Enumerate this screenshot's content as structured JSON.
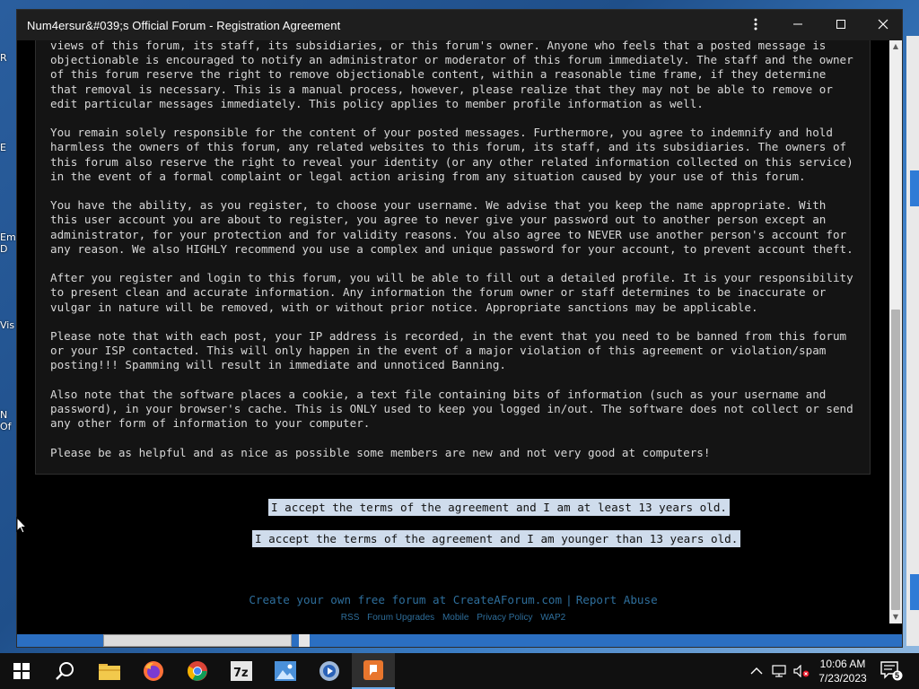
{
  "window": {
    "title": "Num4ersur&#039;s Official Forum - Registration Agreement"
  },
  "agreement": {
    "paragraphs": [
      "views of this forum, its staff, its subsidiaries, or this forum's owner. Anyone who feels that a posted message is objectionable is encouraged to notify an administrator or moderator of this forum immediately. The staff and the owner of this forum reserve the right to remove objectionable content, within a reasonable time frame, if they determine that removal is necessary. This is a manual process, however, please realize that they may not be able to remove or edit particular messages immediately. This policy applies to member profile information as well.",
      "You remain solely responsible for the content of your posted messages. Furthermore, you agree to indemnify and hold harmless the owners of this forum, any related websites to this forum, its staff, and its subsidiaries. The owners of this forum also reserve the right to reveal your identity (or any other related information collected on this service) in the event of a formal complaint or legal action arising from any situation caused by your use of this forum.",
      "You have the ability, as you register, to choose your username. We advise that you keep the name appropriate. With this user account you are about to register, you agree to never give your password out to another person except an administrator, for your protection and for validity reasons. You also agree to NEVER use another person's account for any reason.  We also HIGHLY recommend you use a complex and unique password for your account, to prevent account theft.",
      "After you register and login to this forum, you will be able to fill out a detailed profile. It is your responsibility to present clean and accurate information. Any information the forum owner or staff determines to be inaccurate or vulgar in nature will be removed, with or without prior notice. Appropriate sanctions may be applicable.",
      "Please note that with each post, your IP address is recorded, in the event that you need to be banned from this forum or your ISP contacted. This will only happen in the event of a major violation of this agreement or violation/spam posting!!! Spamming will result in immediate and unnoticed Banning.",
      "Also note that the software places a cookie, a text file containing bits of information (such as your username and password), in your browser's cache. This is ONLY used to keep you logged in/out. The software does not collect or send any other form of information to your computer.",
      "Please be as helpful and as nice as possible some members are new and not very good at computers!"
    ]
  },
  "buttons": {
    "accept_13_plus": "I accept the terms of the agreement and I am at least 13 years old.",
    "accept_under_13": "I accept the terms of the agreement and I am younger than 13 years old."
  },
  "footer": {
    "create_forum": "Create your own free forum at CreateAForum.com",
    "separator": "|",
    "report_abuse": "Report Abuse",
    "links": [
      "RSS",
      "Forum Upgrades",
      "Mobile",
      "Privacy Policy",
      "WAP2"
    ]
  },
  "taskbar": {
    "clock_time": "10:06 AM",
    "clock_date": "7/23/2023",
    "notification_count": "5",
    "apps": [
      "start-icon",
      "search-icon",
      "file-explorer-icon",
      "firefox-icon",
      "chrome-icon",
      "7zip-icon",
      "photos-icon",
      "media-player-icon",
      "forum-app-icon"
    ]
  },
  "desktop": {
    "icon_labels": [
      "R",
      "E",
      "Em\nD",
      "Vis",
      "N\nOf"
    ]
  },
  "colors": {
    "title_bar": "#1e1e1e",
    "agreement_bg": "#141414",
    "accept_button_bg": "#cfdcec",
    "footer_link": "#2e6e9b",
    "taskbar": "#101010"
  }
}
